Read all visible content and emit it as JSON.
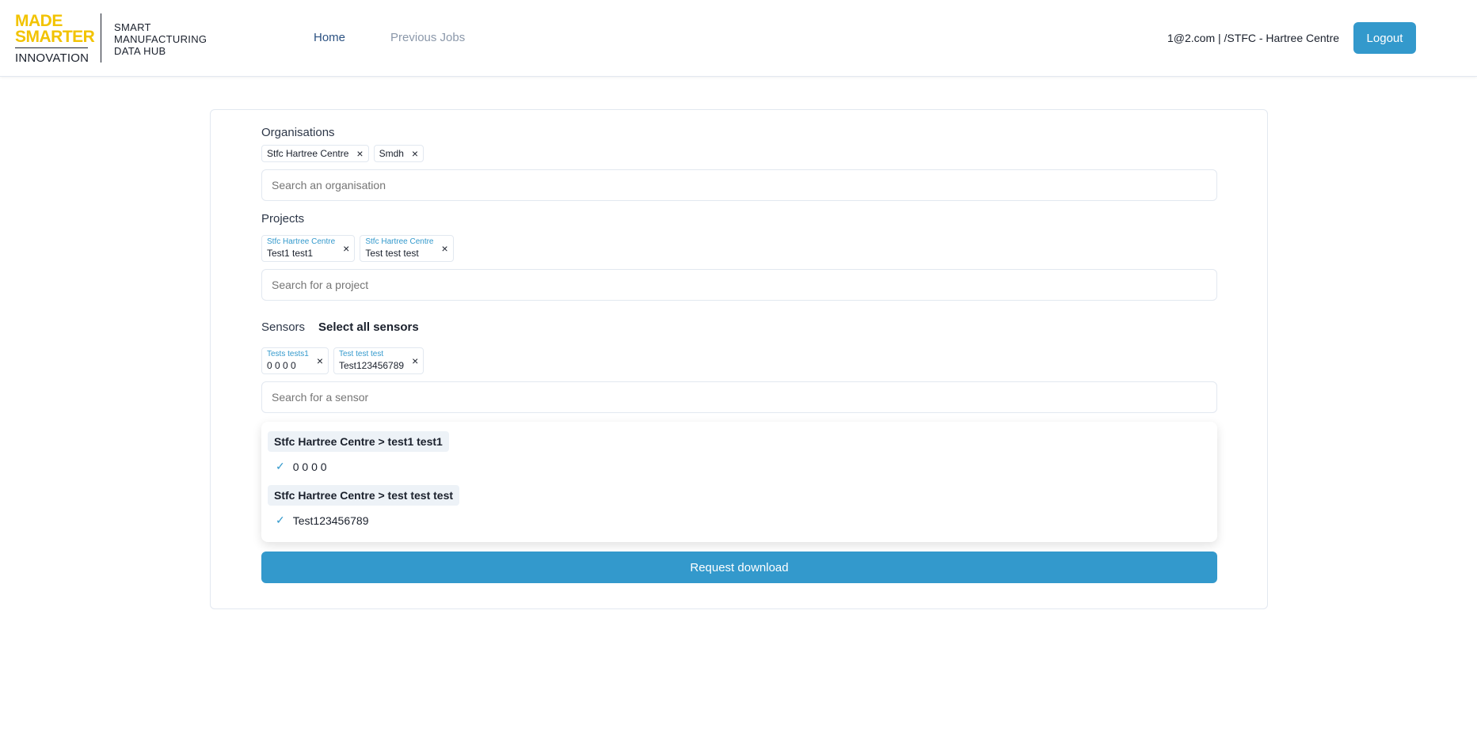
{
  "header": {
    "logo": {
      "line1": "MADE",
      "line2": "SMARTER",
      "line3": "INNOVATION",
      "hub1": "SMART",
      "hub2": "MANUFACTURING",
      "hub3": "DATA HUB"
    },
    "nav": {
      "home": "Home",
      "previous_jobs": "Previous Jobs"
    },
    "user_info": "1@2.com | /STFC - Hartree Centre",
    "logout": "Logout"
  },
  "organisations": {
    "label": "Organisations",
    "tags": [
      "Stfc Hartree Centre",
      "Smdh"
    ],
    "placeholder": "Search an organisation"
  },
  "projects": {
    "label": "Projects",
    "tags": [
      {
        "org": "Stfc Hartree Centre",
        "name": "Test1 test1"
      },
      {
        "org": "Stfc Hartree Centre",
        "name": "Test test test"
      }
    ],
    "placeholder": "Search for a project"
  },
  "sensors": {
    "label": "Sensors",
    "select_all": "Select all sensors",
    "tags": [
      {
        "project": "Tests tests1",
        "name": "0 0 0 0"
      },
      {
        "project": "Test test test",
        "name": "Test123456789"
      }
    ],
    "placeholder": "Search for a sensor",
    "dropdown": [
      {
        "group": "Stfc Hartree Centre > test1 test1",
        "option": "0 0 0 0"
      },
      {
        "group": "Stfc Hartree Centre > test test test",
        "option": "Test123456789"
      }
    ]
  },
  "request_download": "Request download",
  "colors": {
    "accent": "#3399cc",
    "brand_yellow": "#f2c300",
    "nav_active": "#2c5282"
  },
  "icons": {
    "remove": "close-icon",
    "selected": "check-icon"
  }
}
